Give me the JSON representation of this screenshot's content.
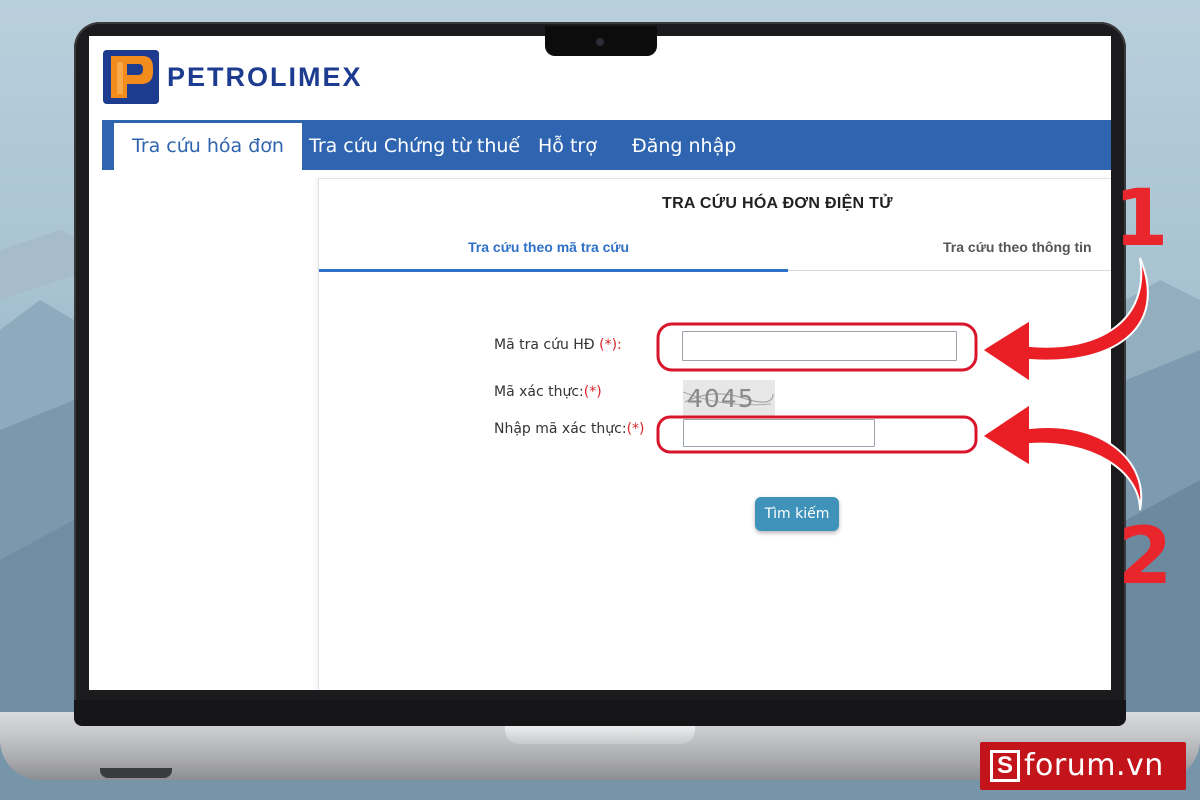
{
  "brand": {
    "name": "PETROLIMEX"
  },
  "nav": {
    "items": [
      {
        "label": "Tra cứu hóa đơn",
        "active": true
      },
      {
        "label": "Tra cứu Chứng từ thuế",
        "active": false
      },
      {
        "label": "Hỗ trợ",
        "active": false
      },
      {
        "label": "Đăng nhập",
        "active": false
      }
    ]
  },
  "main": {
    "title": "TRA CỨU HÓA ĐƠN ĐIỆN TỬ",
    "tabs": [
      {
        "label": "Tra cứu theo mã tra cứu",
        "active": true
      },
      {
        "label": "Tra cứu theo thông tin",
        "active": false
      }
    ],
    "form": {
      "lookup_code_label": "Mã tra cứu HĐ",
      "lookup_code_required": "(*):",
      "lookup_code_value": "",
      "captcha_label": "Mã xác thực:",
      "captcha_required": "(*)",
      "captcha_image_text": "4045",
      "captcha_input_label": "Nhập mã xác thực:",
      "captcha_input_required": "(*)",
      "captcha_input_value": "",
      "search_button": "Tìm kiếm"
    }
  },
  "annotations": {
    "step1": "1",
    "step2": "2",
    "highlight_color": "#d9152b"
  },
  "watermark": {
    "logo_letter": "S",
    "text": "forum.vn"
  },
  "colors": {
    "nav_blue": "#2f65b0",
    "accent": "#2f70c8",
    "button": "#3f93ba",
    "required": "#d9242a"
  }
}
